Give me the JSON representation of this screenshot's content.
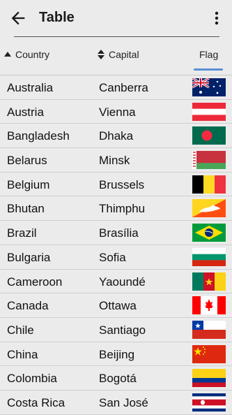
{
  "app_bar": {
    "title": "Table"
  },
  "table": {
    "headers": {
      "country": "Country",
      "capital": "Capital",
      "flag": "Flag"
    },
    "rows": [
      {
        "country": "Australia",
        "capital": "Canberra",
        "flag_icon": "australia-flag"
      },
      {
        "country": "Austria",
        "capital": "Vienna",
        "flag_icon": "austria-flag"
      },
      {
        "country": "Bangladesh",
        "capital": "Dhaka",
        "flag_icon": "bangladesh-flag"
      },
      {
        "country": "Belarus",
        "capital": "Minsk",
        "flag_icon": "belarus-flag"
      },
      {
        "country": "Belgium",
        "capital": "Brussels",
        "flag_icon": "belgium-flag"
      },
      {
        "country": "Bhutan",
        "capital": "Thimphu",
        "flag_icon": "bhutan-flag"
      },
      {
        "country": "Brazil",
        "capital": "Brasília",
        "flag_icon": "brazil-flag"
      },
      {
        "country": "Bulgaria",
        "capital": "Sofia",
        "flag_icon": "bulgaria-flag"
      },
      {
        "country": "Cameroon",
        "capital": "Yaoundé",
        "flag_icon": "cameroon-flag"
      },
      {
        "country": "Canada",
        "capital": "Ottawa",
        "flag_icon": "canada-flag"
      },
      {
        "country": "Chile",
        "capital": "Santiago",
        "flag_icon": "chile-flag"
      },
      {
        "country": "China",
        "capital": "Beijing",
        "flag_icon": "china-flag"
      },
      {
        "country": "Colombia",
        "capital": "Bogotá",
        "flag_icon": "colombia-flag"
      },
      {
        "country": "Costa Rica",
        "capital": "San José",
        "flag_icon": "costa-rica-flag"
      }
    ]
  }
}
